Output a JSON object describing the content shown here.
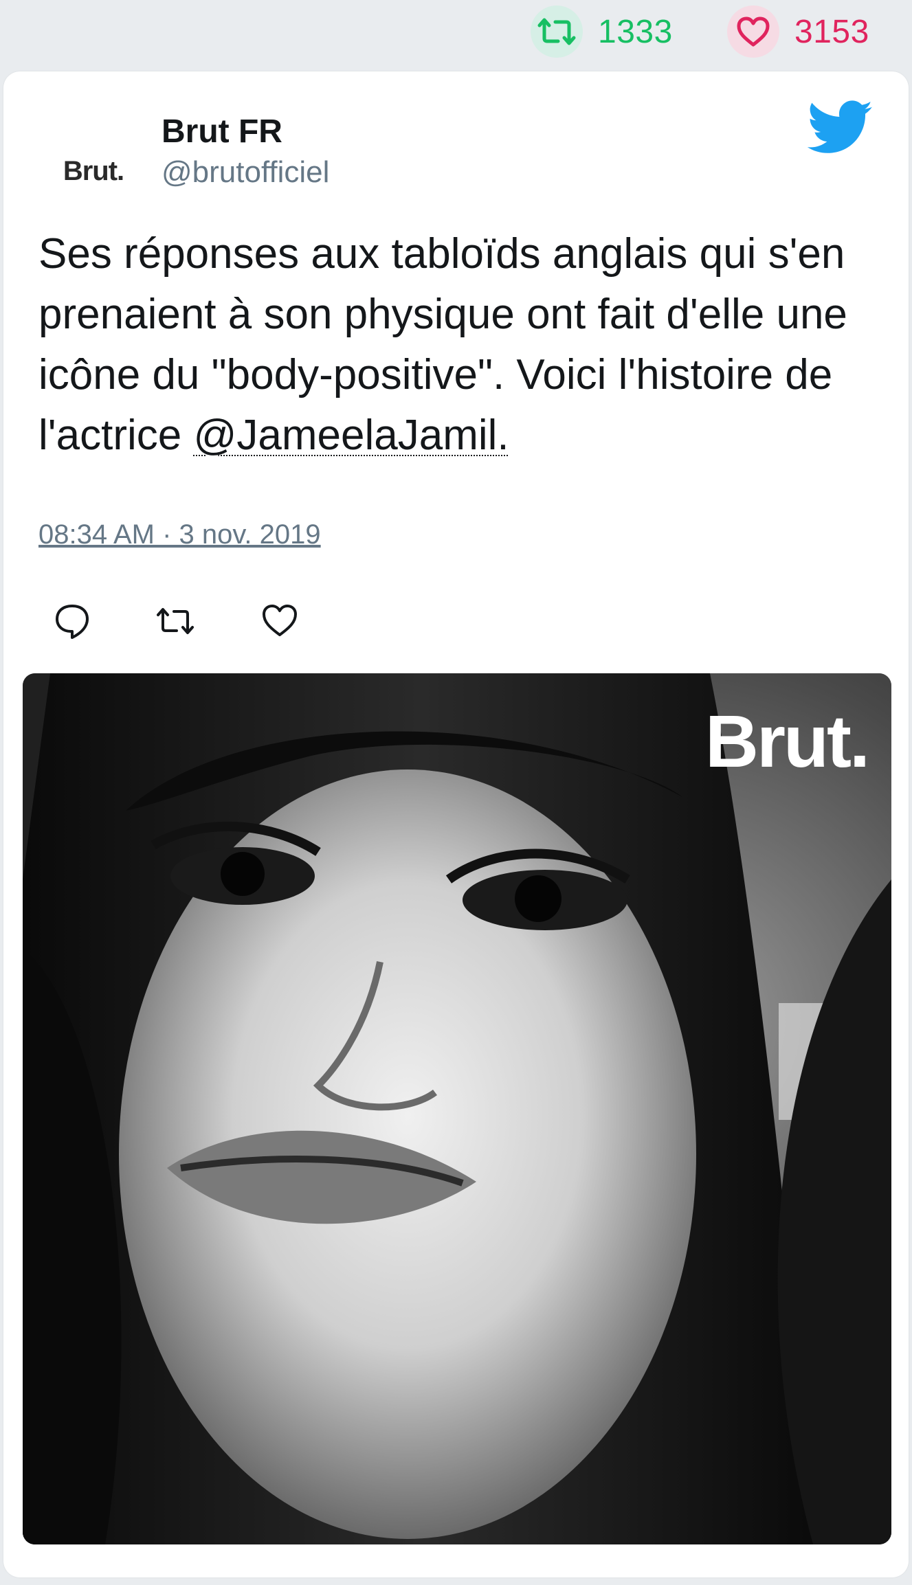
{
  "stats": {
    "retweet_count": "1333",
    "like_count": "3153",
    "retweet_icon": "retweet-icon",
    "like_icon": "heart-icon",
    "retweet_color": "#17bf63",
    "like_color": "#e0245e"
  },
  "tweet": {
    "author_name": "Brut FR",
    "author_handle": "@brutofficiel",
    "avatar_text": "Brut.",
    "text_main": "Ses réponses aux tabloïds anglais qui s'en prenaient à son physique ont fait d'elle une icône du \"body-positive\". Voici l'histoire de l'actrice ",
    "mention": "@JameelaJamil.",
    "timestamp": "08:34 AM · 3 nov. 2019",
    "actions": [
      "reply-icon",
      "retweet-icon",
      "heart-icon"
    ],
    "brand_color": "#1da1f2"
  },
  "media": {
    "watermark": "Brut.",
    "description_icon": "portrait-photo"
  }
}
